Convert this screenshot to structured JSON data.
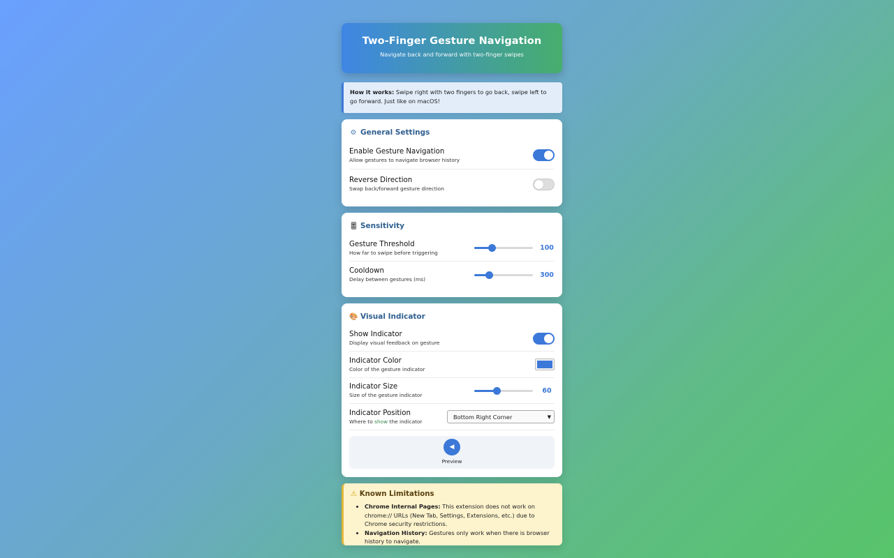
{
  "header": {
    "title": "Two-Finger Gesture Navigation",
    "subtitle": "Navigate back and forward with two-finger swipes"
  },
  "info": {
    "bold": "How it works:",
    "text": " Swipe right with two fingers to go back, swipe left to go forward. Just like on macOS!"
  },
  "general": {
    "icon": "gear-icon",
    "title": "General Settings",
    "enable": {
      "label": "Enable Gesture Navigation",
      "desc": "Allow gestures to navigate browser history",
      "on": true
    },
    "reverse": {
      "label": "Reverse Direction",
      "desc": "Swap back/forward gesture direction",
      "on": false
    }
  },
  "sensitivity": {
    "icon": "slider-icon",
    "title": "Sensitivity",
    "threshold": {
      "label": "Gesture Threshold",
      "desc": "How far to swipe before triggering",
      "value": "100",
      "fraction": 0.3
    },
    "cooldown": {
      "label": "Cooldown",
      "desc": "Delay between gestures (ms)",
      "value": "300",
      "fraction": 0.25
    }
  },
  "visual": {
    "icon": "palette-icon",
    "title": "Visual Indicator",
    "show": {
      "label": "Show Indicator",
      "desc": "Display visual feedback on gesture",
      "on": true
    },
    "color": {
      "label": "Indicator Color",
      "desc": "Color of the gesture indicator",
      "value": "#3c78d8"
    },
    "size": {
      "label": "Indicator Size",
      "desc": "Size of the gesture indicator",
      "value": "60",
      "fraction": 0.38
    },
    "position": {
      "label": "Indicator Position",
      "desc_pre": "Where to ",
      "desc_hl": "show",
      "desc_post": " the indicator",
      "selected": "Bottom Right Corner"
    },
    "preview": {
      "icon": "left-arrow-icon",
      "label": "Preview"
    }
  },
  "limitations": {
    "icon": "warning-icon",
    "title": "Known Limitations",
    "items": [
      {
        "bold": "Chrome Internal Pages:",
        "text": " This extension does not work on chrome:// URLs (New Tab, Settings, Extensions, etc.) due to Chrome security restrictions."
      },
      {
        "bold": "Navigation History:",
        "text": " Gestures only work when there is browser history to navigate."
      }
    ]
  },
  "colors": {
    "accent": "#3c78d8",
    "success": "#46ae6d",
    "warning_bg": "#fdf3cd"
  }
}
